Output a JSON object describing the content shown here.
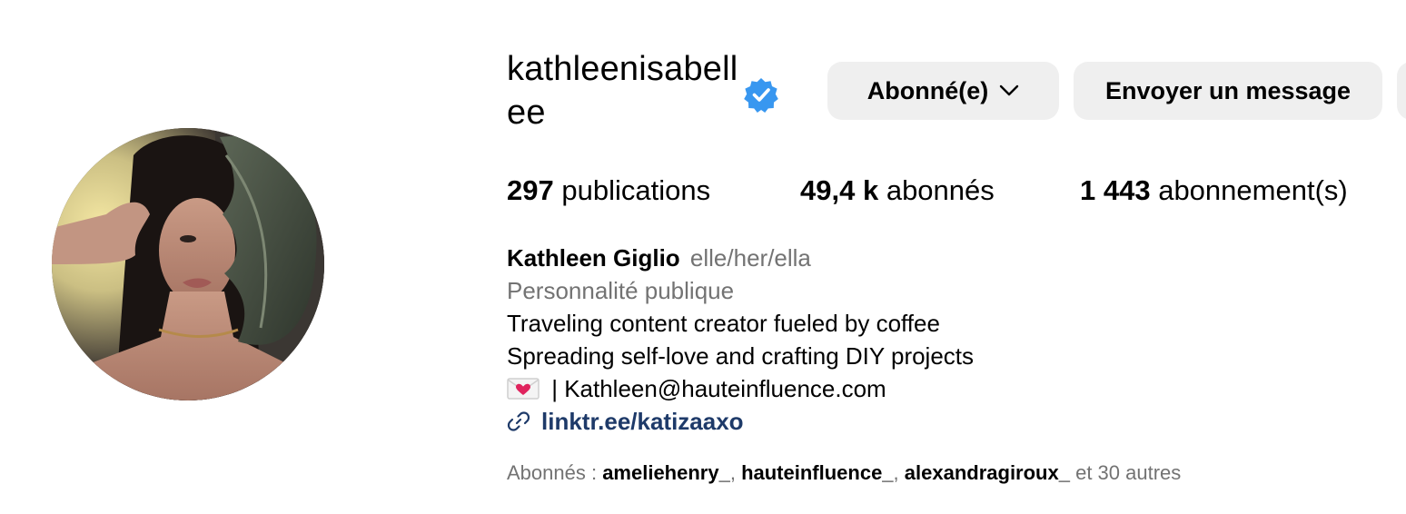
{
  "profile": {
    "username": "kathleenisabellee",
    "verified_icon": "verified-badge-icon",
    "accent_color": "#3897f0",
    "buttons": {
      "follow_label": "Abonné(e)",
      "message_label": "Envoyer un message"
    },
    "stats": {
      "posts_count": "297",
      "posts_label": "publications",
      "followers_count": "49,4 k",
      "followers_label": "abonnés",
      "following_count": "1 443",
      "following_label": "abonnement(s)"
    },
    "bio": {
      "full_name": "Kathleen Giglio",
      "pronouns": "elle/her/ella",
      "category": "Personnalité publique",
      "line1": "Traveling content creator fueled by coffee",
      "line2": "Spreading self-love and crafting DIY projects",
      "email_line": " | Kathleen@hauteinfluence.com",
      "link": "linktr.ee/katizaaxo",
      "link_color": "#1e3a69"
    },
    "followed_by": {
      "prefix": "Abonnés : ",
      "accounts": [
        "ameliehenry_",
        "hauteinfluence_",
        "alexandragiroux_"
      ],
      "separator": ", ",
      "suffix": " et 30 autres"
    }
  }
}
